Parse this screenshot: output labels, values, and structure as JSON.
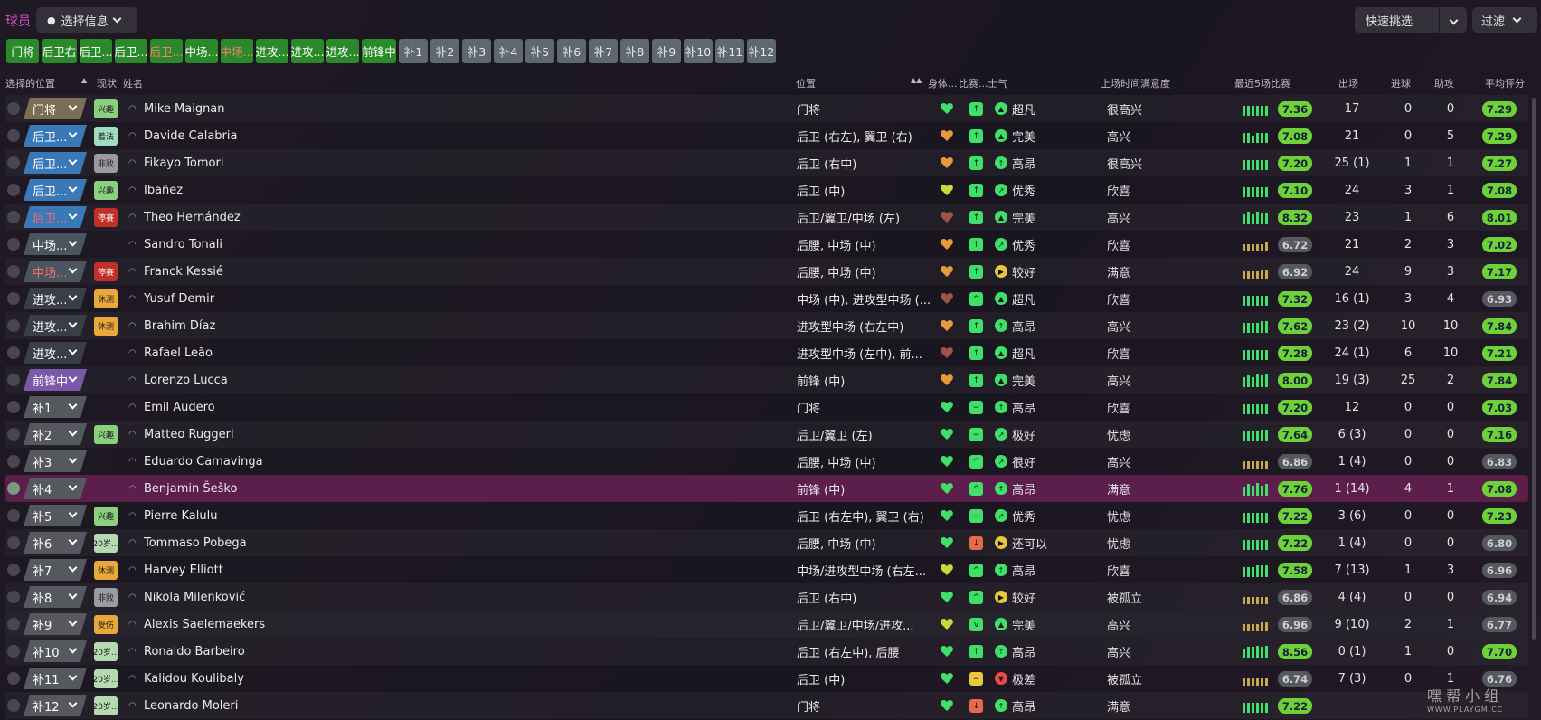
{
  "header": {
    "title": "球员",
    "select_info": "选择信息",
    "quick_pick": "快速挑选",
    "filter": "过滤"
  },
  "tabs": [
    {
      "label": "门将",
      "style": "green"
    },
    {
      "label": "后卫右",
      "style": "green"
    },
    {
      "label": "后卫...",
      "style": "green"
    },
    {
      "label": "后卫...",
      "style": "green"
    },
    {
      "label": "后卫...",
      "style": "red-text"
    },
    {
      "label": "中场...",
      "style": "green"
    },
    {
      "label": "中场...",
      "style": "red-text"
    },
    {
      "label": "进攻...",
      "style": "green"
    },
    {
      "label": "进攻...",
      "style": "green"
    },
    {
      "label": "进攻...",
      "style": "green"
    },
    {
      "label": "前锋中",
      "style": "green"
    },
    {
      "label": "补1",
      "style": "grey"
    },
    {
      "label": "补2",
      "style": "grey"
    },
    {
      "label": "补3",
      "style": "grey"
    },
    {
      "label": "补4",
      "style": "grey"
    },
    {
      "label": "补5",
      "style": "grey"
    },
    {
      "label": "补6",
      "style": "grey"
    },
    {
      "label": "补7",
      "style": "grey"
    },
    {
      "label": "补8",
      "style": "grey"
    },
    {
      "label": "补9",
      "style": "grey"
    },
    {
      "label": "补10",
      "style": "grey"
    },
    {
      "label": "补11",
      "style": "grey"
    },
    {
      "label": "补12",
      "style": "grey"
    }
  ],
  "columns": {
    "select_pos": "选择的位置",
    "status": "现状",
    "name": "姓名",
    "position": "位置",
    "fitness": "身体...",
    "match": "比赛...",
    "morale": "士气",
    "satisfaction": "上场时间满意度",
    "last5": "最近5场比赛",
    "apps": "出场",
    "goals": "进球",
    "assists": "助攻",
    "avg": "平均评分"
  },
  "colors": {
    "gk": "#7b6e55",
    "def": "#3a79b8",
    "mid": "#4a5560",
    "att": "#3a3f47",
    "fwd": "#7a5aa8",
    "sub": "#55585f",
    "heart_green": "#3fe06a",
    "heart_orange": "#e89a3a",
    "heart_brown": "#a0524a",
    "heart_yellow": "#c9d93a",
    "rating_green": "#6fd13a",
    "rating_grey": "#55585f"
  },
  "players": [
    {
      "pos": "门将",
      "pos_color": "gk",
      "pos_red": false,
      "badge": "兴趣",
      "badge_color": "#8ad07e",
      "name": "Mike Maignan",
      "position": "门将",
      "heart": "heart_green",
      "match_color": "#3fe06a",
      "match_icon": "↑",
      "morale_color": "#3fe06a",
      "morale_icon": "▲",
      "morale": "超凡",
      "sat": "很高兴",
      "bar_color": "#3fe06a",
      "bars": [
        0.8,
        0.8,
        0.8,
        0.8,
        0.8,
        0.8
      ],
      "rating": "7.36",
      "rating_color": "rating_green",
      "apps": "17",
      "goals": "0",
      "assists": "0",
      "avg": "7.29",
      "avg_color": "rating_green"
    },
    {
      "pos": "后卫...",
      "pos_color": "def",
      "pos_red": false,
      "badge": "着法",
      "badge_color": "#9fdcc0",
      "name": "Davide Calabria",
      "position": "后卫 (右左), 翼卫 (右)",
      "heart": "heart_orange",
      "match_color": "#3fe06a",
      "match_icon": "↑",
      "morale_color": "#3fe06a",
      "morale_icon": "▲",
      "morale": "完美",
      "sat": "高兴",
      "bar_color": "#3fe06a",
      "bars": [
        0.8,
        0.8,
        0.6,
        0.8,
        0.8,
        0.8
      ],
      "rating": "7.08",
      "rating_color": "rating_green",
      "apps": "21",
      "goals": "0",
      "assists": "5",
      "avg": "7.29",
      "avg_color": "rating_green"
    },
    {
      "pos": "后卫...",
      "pos_color": "def",
      "pos_red": false,
      "badge": "非败",
      "badge_color": "#9a9aa0",
      "name": "Fikayo Tomori",
      "position": "后卫 (右中)",
      "heart": "heart_orange",
      "match_color": "#3fe06a",
      "match_icon": "↑",
      "morale_color": "#3fe06a",
      "morale_icon": "↑",
      "morale": "高昂",
      "sat": "很高兴",
      "bar_color": "#3fe06a",
      "bars": [
        0.8,
        0.8,
        0.8,
        0.8,
        0.8,
        0.8
      ],
      "rating": "7.20",
      "rating_color": "rating_green",
      "apps": "25 (1)",
      "goals": "1",
      "assists": "1",
      "avg": "7.27",
      "avg_color": "rating_green"
    },
    {
      "pos": "后卫...",
      "pos_color": "def",
      "pos_red": false,
      "badge": "兴趣",
      "badge_color": "#8ad07e",
      "name": "Ibañez",
      "position": "后卫 (中)",
      "heart": "heart_yellow",
      "match_color": "#3fe06a",
      "match_icon": "↑",
      "morale_color": "#3fe06a",
      "morale_icon": "↗",
      "morale": "优秀",
      "sat": "欣喜",
      "bar_color": "#3fe06a",
      "bars": [
        0.8,
        0.8,
        0.8,
        0.8,
        0.8,
        0.8
      ],
      "rating": "7.10",
      "rating_color": "rating_green",
      "apps": "24",
      "goals": "3",
      "assists": "1",
      "avg": "7.08",
      "avg_color": "rating_green"
    },
    {
      "pos": "后卫...",
      "pos_color": "def",
      "pos_red": true,
      "badge": "停赛",
      "badge_color": "#c0302a",
      "name": "Theo Hernández",
      "position": "后卫/翼卫/中场 (左)",
      "heart": "heart_brown",
      "match_color": "#3fe06a",
      "match_icon": "↑",
      "morale_color": "#3fe06a",
      "morale_icon": "▲",
      "morale": "完美",
      "sat": "高兴",
      "bar_color": "#3fe06a",
      "bars": [
        0.8,
        1,
        0.8,
        1,
        0.9,
        0.9
      ],
      "rating": "8.32",
      "rating_color": "rating_green",
      "apps": "23",
      "goals": "1",
      "assists": "6",
      "avg": "8.01",
      "avg_color": "rating_green"
    },
    {
      "pos": "中场...",
      "pos_color": "mid",
      "pos_red": false,
      "badge": "",
      "badge_color": "",
      "name": "Sandro Tonali",
      "position": "后腰, 中场 (中)",
      "heart": "heart_orange",
      "match_color": "#3fe06a",
      "match_icon": "↑",
      "morale_color": "#3fe06a",
      "morale_icon": "↗",
      "morale": "优秀",
      "sat": "欣喜",
      "bar_color": "#c8a84a",
      "bars": [
        0.6,
        0.6,
        0.6,
        0.6,
        0.6,
        0.7
      ],
      "rating": "6.72",
      "rating_color": "rating_grey",
      "apps": "21",
      "goals": "2",
      "assists": "3",
      "avg": "7.02",
      "avg_color": "rating_green"
    },
    {
      "pos": "中场...",
      "pos_color": "mid",
      "pos_red": true,
      "badge": "停赛",
      "badge_color": "#c0302a",
      "name": "Franck Kessié",
      "position": "后腰, 中场 (中)",
      "heart": "heart_orange",
      "match_color": "#3fe06a",
      "match_icon": "↑",
      "morale_color": "#e8c83a",
      "morale_icon": "▶",
      "morale": "较好",
      "sat": "满意",
      "bar_color": "#c8a84a",
      "bars": [
        0.6,
        0.6,
        0.6,
        0.6,
        0.7,
        0.7
      ],
      "rating": "6.92",
      "rating_color": "rating_grey",
      "apps": "24",
      "goals": "9",
      "assists": "3",
      "avg": "7.17",
      "avg_color": "rating_green"
    },
    {
      "pos": "进攻...",
      "pos_color": "att",
      "pos_red": false,
      "badge": "休测",
      "badge_color": "#e8a83a",
      "name": "Yusuf Demir",
      "position": "中场 (中), 进攻型中场 (...",
      "heart": "heart_brown",
      "match_color": "#3fe06a",
      "match_icon": "^",
      "morale_color": "#3fe06a",
      "morale_icon": "▲",
      "morale": "超凡",
      "sat": "欣喜",
      "bar_color": "#3fe06a",
      "bars": [
        0.8,
        0.8,
        0.8,
        0.8,
        0.8,
        0.8
      ],
      "rating": "7.32",
      "rating_color": "rating_green",
      "apps": "16 (1)",
      "goals": "3",
      "assists": "4",
      "avg": "6.93",
      "avg_color": "rating_grey"
    },
    {
      "pos": "进攻...",
      "pos_color": "att",
      "pos_red": false,
      "badge": "休测",
      "badge_color": "#e8a83a",
      "name": "Brahim Díaz",
      "position": "进攻型中场 (右左中)",
      "heart": "heart_orange",
      "match_color": "#3fe06a",
      "match_icon": "↑",
      "morale_color": "#3fe06a",
      "morale_icon": "↑",
      "morale": "高昂",
      "sat": "高兴",
      "bar_color": "#3fe06a",
      "bars": [
        0.8,
        0.8,
        0.8,
        0.8,
        0.9,
        0.9
      ],
      "rating": "7.62",
      "rating_color": "rating_green",
      "apps": "23 (2)",
      "goals": "10",
      "assists": "10",
      "avg": "7.84",
      "avg_color": "rating_green"
    },
    {
      "pos": "进攻...",
      "pos_color": "att",
      "pos_red": false,
      "badge": "",
      "badge_color": "",
      "name": "Rafael Leão",
      "position": "进攻型中场 (左中), 前...",
      "heart": "heart_brown",
      "match_color": "#3fe06a",
      "match_icon": "↑",
      "morale_color": "#3fe06a",
      "morale_icon": "▲",
      "morale": "超凡",
      "sat": "欣喜",
      "bar_color": "#3fe06a",
      "bars": [
        0.8,
        0.8,
        0.8,
        0.8,
        0.8,
        0.8
      ],
      "rating": "7.28",
      "rating_color": "rating_green",
      "apps": "24 (1)",
      "goals": "6",
      "assists": "10",
      "avg": "7.21",
      "avg_color": "rating_green"
    },
    {
      "pos": "前锋中",
      "pos_color": "fwd",
      "pos_red": false,
      "badge": "",
      "badge_color": "",
      "name": "Lorenzo Lucca",
      "position": "前锋 (中)",
      "heart": "heart_orange",
      "match_color": "#3fe06a",
      "match_icon": "↑",
      "morale_color": "#3fe06a",
      "morale_icon": "▲",
      "morale": "完美",
      "sat": "高兴",
      "bar_color": "#3fe06a",
      "bars": [
        0.8,
        0.9,
        0.8,
        1,
        0.9,
        1
      ],
      "rating": "8.00",
      "rating_color": "rating_green",
      "apps": "19 (3)",
      "goals": "25",
      "assists": "2",
      "avg": "7.84",
      "avg_color": "rating_green"
    },
    {
      "pos": "补1",
      "pos_color": "sub",
      "pos_red": false,
      "badge": "",
      "badge_color": "",
      "name": "Emil Audero",
      "position": "门将",
      "heart": "heart_green",
      "match_color": "#3fe06a",
      "match_icon": "−",
      "morale_color": "#3fe06a",
      "morale_icon": "↑",
      "morale": "高昂",
      "sat": "欣喜",
      "bar_color": "#3fe06a",
      "bars": [
        0.8,
        0.8,
        0.8,
        0.8,
        0.8,
        0.8
      ],
      "rating": "7.20",
      "rating_color": "rating_green",
      "apps": "12",
      "goals": "0",
      "assists": "0",
      "avg": "7.03",
      "avg_color": "rating_green"
    },
    {
      "pos": "补2",
      "pos_color": "sub",
      "pos_red": false,
      "badge": "兴趣",
      "badge_color": "#8ad07e",
      "name": "Matteo Ruggeri",
      "position": "后卫/翼卫 (左)",
      "heart": "heart_green",
      "match_color": "#3fe06a",
      "match_icon": "−",
      "morale_color": "#3fe06a",
      "morale_icon": "↗",
      "morale": "极好",
      "sat": "忧虑",
      "bar_color": "#3fe06a",
      "bars": [
        0.8,
        0.8,
        0.8,
        0.8,
        0.9,
        0.9
      ],
      "rating": "7.64",
      "rating_color": "rating_green",
      "apps": "6 (3)",
      "goals": "0",
      "assists": "0",
      "avg": "7.16",
      "avg_color": "rating_green"
    },
    {
      "pos": "补3",
      "pos_color": "sub",
      "pos_red": false,
      "badge": "",
      "badge_color": "",
      "name": "Eduardo Camavinga",
      "position": "后腰, 中场 (中)",
      "heart": "heart_green",
      "match_color": "#3fe06a",
      "match_icon": "^",
      "morale_color": "#3fe06a",
      "morale_icon": "↗",
      "morale": "很好",
      "sat": "高兴",
      "bar_color": "#c8a84a",
      "bars": [
        0.6,
        0.6,
        0.6,
        0.6,
        0.6,
        0.6
      ],
      "rating": "6.86",
      "rating_color": "rating_grey",
      "apps": "1 (4)",
      "goals": "0",
      "assists": "0",
      "avg": "6.83",
      "avg_color": "rating_grey"
    },
    {
      "pos": "补4",
      "pos_color": "sub",
      "pos_red": false,
      "badge": "",
      "badge_color": "",
      "name": "Benjamin Šeško",
      "position": "前锋 (中)",
      "heart": "heart_green",
      "match_color": "#3fe06a",
      "match_icon": "^",
      "morale_color": "#3fe06a",
      "morale_icon": "↑",
      "morale": "高昂",
      "sat": "满意",
      "bar_color": "#3fe06a",
      "bars": [
        0.7,
        0.9,
        0.8,
        1,
        0.8,
        0.9
      ],
      "rating": "7.76",
      "rating_color": "rating_green",
      "apps": "1 (14)",
      "goals": "4",
      "assists": "1",
      "avg": "7.08",
      "avg_color": "rating_green",
      "selected": true
    },
    {
      "pos": "补5",
      "pos_color": "sub",
      "pos_red": false,
      "badge": "兴趣",
      "badge_color": "#8ad07e",
      "name": "Pierre Kalulu",
      "position": "后卫 (右左中), 翼卫 (右)",
      "heart": "heart_green",
      "match_color": "#3fe06a",
      "match_icon": "−",
      "morale_color": "#3fe06a",
      "morale_icon": "↗",
      "morale": "优秀",
      "sat": "忧虑",
      "bar_color": "#3fe06a",
      "bars": [
        0.8,
        0.8,
        0.8,
        0.8,
        0.8,
        0.8
      ],
      "rating": "7.22",
      "rating_color": "rating_green",
      "apps": "3 (6)",
      "goals": "0",
      "assists": "0",
      "avg": "7.23",
      "avg_color": "rating_green"
    },
    {
      "pos": "补6",
      "pos_color": "sub",
      "pos_red": false,
      "badge": "20岁...",
      "badge_color": "#b5d9b0",
      "name": "Tommaso Pobega",
      "position": "后腰, 中场 (中)",
      "heart": "heart_green",
      "match_color": "#e8684a",
      "match_icon": "↓",
      "morale_color": "#e8c83a",
      "morale_icon": "▶",
      "morale": "还可以",
      "sat": "忧虑",
      "bar_color": "#3fe06a",
      "bars": [
        0.8,
        0.8,
        0.8,
        0.8,
        0.8,
        0.8
      ],
      "rating": "7.22",
      "rating_color": "rating_green",
      "apps": "1 (4)",
      "goals": "0",
      "assists": "0",
      "avg": "6.80",
      "avg_color": "rating_grey"
    },
    {
      "pos": "补7",
      "pos_color": "sub",
      "pos_red": false,
      "badge": "休测",
      "badge_color": "#e8a83a",
      "name": "Harvey Elliott",
      "position": "中场/进攻型中场 (右左...",
      "heart": "heart_yellow",
      "match_color": "#3fe06a",
      "match_icon": "^",
      "morale_color": "#3fe06a",
      "morale_icon": "↑",
      "morale": "高昂",
      "sat": "欣喜",
      "bar_color": "#3fe06a",
      "bars": [
        0.8,
        0.8,
        0.8,
        0.9,
        0.9,
        0.9
      ],
      "rating": "7.58",
      "rating_color": "rating_green",
      "apps": "7 (13)",
      "goals": "1",
      "assists": "3",
      "avg": "6.96",
      "avg_color": "rating_grey"
    },
    {
      "pos": "补8",
      "pos_color": "sub",
      "pos_red": false,
      "badge": "非败",
      "badge_color": "#9a9aa0",
      "name": "Nikola Milenković",
      "position": "后卫 (右中)",
      "heart": "heart_green",
      "match_color": "#3fe06a",
      "match_icon": "^",
      "morale_color": "#e8c83a",
      "morale_icon": "▶",
      "morale": "较好",
      "sat": "被孤立",
      "bar_color": "#c8a84a",
      "bars": [
        0.6,
        0.6,
        0.6,
        0.6,
        0.6,
        0.6
      ],
      "rating": "6.86",
      "rating_color": "rating_grey",
      "apps": "4 (4)",
      "goals": "0",
      "assists": "0",
      "avg": "6.94",
      "avg_color": "rating_grey"
    },
    {
      "pos": "补9",
      "pos_color": "sub",
      "pos_red": false,
      "badge": "受伤",
      "badge_color": "#e8a83a",
      "name": "Alexis Saelemaekers",
      "position": "后卫/翼卫/中场/进攻...",
      "heart": "heart_yellow",
      "match_color": "#3fe06a",
      "match_icon": "v",
      "morale_color": "#3fe06a",
      "morale_icon": "▲",
      "morale": "完美",
      "sat": "高兴",
      "bar_color": "#c8a84a",
      "bars": [
        0.6,
        0.6,
        0.6,
        0.6,
        0.7,
        0.7
      ],
      "rating": "6.96",
      "rating_color": "rating_grey",
      "apps": "9 (10)",
      "goals": "2",
      "assists": "1",
      "avg": "6.77",
      "avg_color": "rating_grey"
    },
    {
      "pos": "补10",
      "pos_color": "sub",
      "pos_red": false,
      "badge": "20岁...",
      "badge_color": "#b5d9b0",
      "name": "Ronaldo Barbeiro",
      "position": "后卫 (右左中), 后腰",
      "heart": "heart_green",
      "match_color": "#3fe06a",
      "match_icon": "↑",
      "morale_color": "#3fe06a",
      "morale_icon": "↑",
      "morale": "高昂",
      "sat": "高兴",
      "bar_color": "#3fe06a",
      "bars": [
        0.8,
        0.9,
        0.9,
        1,
        0.9,
        1
      ],
      "rating": "8.56",
      "rating_color": "rating_green",
      "apps": "0 (1)",
      "goals": "1",
      "assists": "0",
      "avg": "7.70",
      "avg_color": "rating_green"
    },
    {
      "pos": "补11",
      "pos_color": "sub",
      "pos_red": false,
      "badge": "20岁...",
      "badge_color": "#b5d9b0",
      "name": "Kalidou Koulibaly",
      "position": "后卫 (中)",
      "heart": "heart_green",
      "match_color": "#e8c83a",
      "match_icon": "−",
      "morale_color": "#e84a4a",
      "morale_icon": "▼",
      "morale": "极差",
      "sat": "被孤立",
      "bar_color": "#c8a84a",
      "bars": [
        0.6,
        0.6,
        0.6,
        0.6,
        0.6,
        0.6
      ],
      "rating": "6.74",
      "rating_color": "rating_grey",
      "apps": "7 (3)",
      "goals": "0",
      "assists": "1",
      "avg": "6.76",
      "avg_color": "rating_grey"
    },
    {
      "pos": "补12",
      "pos_color": "sub",
      "pos_red": false,
      "badge": "20岁...",
      "badge_color": "#b5d9b0",
      "name": "Leonardo Moleri",
      "position": "门将",
      "heart": "heart_green",
      "match_color": "#e8684a",
      "match_icon": "↓",
      "morale_color": "#3fe06a",
      "morale_icon": "↑",
      "morale": "高昂",
      "sat": "满意",
      "bar_color": "#3fe06a",
      "bars": [
        0.8,
        0.8,
        0.8,
        0.8,
        0.8,
        0.8
      ],
      "rating": "7.22",
      "rating_color": "rating_green",
      "apps": "-",
      "goals": "-",
      "assists": "",
      "avg": "",
      "avg_color": "rating_grey"
    }
  ],
  "watermark": {
    "text": "嘿 帮 小 组",
    "sub": "WWW.PLAYGM.CC"
  }
}
